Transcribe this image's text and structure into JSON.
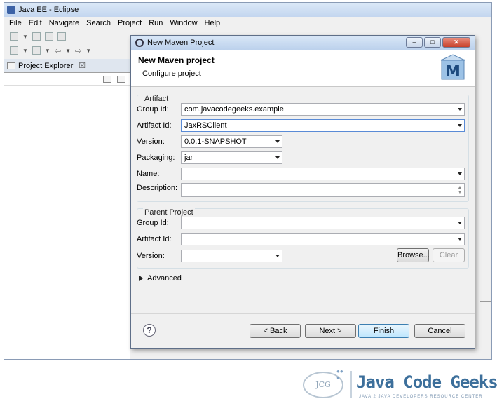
{
  "app": {
    "title": "Java EE - Eclipse"
  },
  "menu": [
    "File",
    "Edit",
    "Navigate",
    "Search",
    "Project",
    "Run",
    "Window",
    "Help"
  ],
  "explorer": {
    "tab_label": "Project Explorer",
    "tab_close": "☒"
  },
  "dialog": {
    "window_title": "New Maven Project",
    "header_title": "New Maven project",
    "header_subtitle": "Configure project",
    "logo_letter": "M",
    "artifact_group_label": "Artifact",
    "group_id": {
      "label": "Group Id:",
      "value": "com.javacodegeeks.example"
    },
    "artifact_id": {
      "label": "Artifact Id:",
      "value": "JaxRSClient"
    },
    "version": {
      "label": "Version:",
      "value": "0.0.1-SNAPSHOT"
    },
    "packaging": {
      "label": "Packaging:",
      "value": "jar"
    },
    "name": {
      "label": "Name:",
      "value": ""
    },
    "description": {
      "label": "Description:",
      "value": ""
    },
    "parent_group_label": "Parent Project",
    "parent_group_id": {
      "label": "Group Id:",
      "value": ""
    },
    "parent_artifact_id": {
      "label": "Artifact Id:",
      "value": ""
    },
    "parent_version": {
      "label": "Version:",
      "value": ""
    },
    "browse_label": "Browse...",
    "clear_label": "Clear",
    "advanced_label": "Advanced",
    "back_label": "< Back",
    "next_label": "Next >",
    "finish_label": "Finish",
    "cancel_label": "Cancel",
    "help_glyph": "?"
  },
  "watermark": {
    "logo_text": "JCG",
    "brand": "Java Code Geeks",
    "tagline": "JAVA 2 JAVA DEVELOPERS RESOURCE CENTER"
  }
}
